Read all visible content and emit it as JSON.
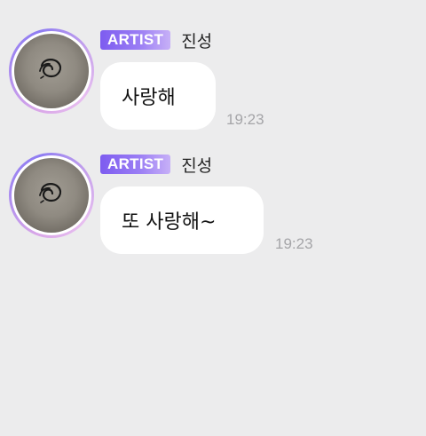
{
  "messages": [
    {
      "badge": "ARTIST",
      "sender": "진성",
      "text": "사랑해",
      "time": "19:23"
    },
    {
      "badge": "ARTIST",
      "sender": "진성",
      "text": "또 사랑해~",
      "time": "19:23"
    }
  ],
  "colors": {
    "background": "#ececed",
    "bubble": "#ffffff",
    "badge_gradient_start": "#7d5cf0",
    "badge_gradient_end": "#c7b0f7",
    "avatar_ring": "#a98bf0",
    "time_text": "#a5a5a8"
  },
  "icons": {
    "avatar": "profile-photo"
  }
}
